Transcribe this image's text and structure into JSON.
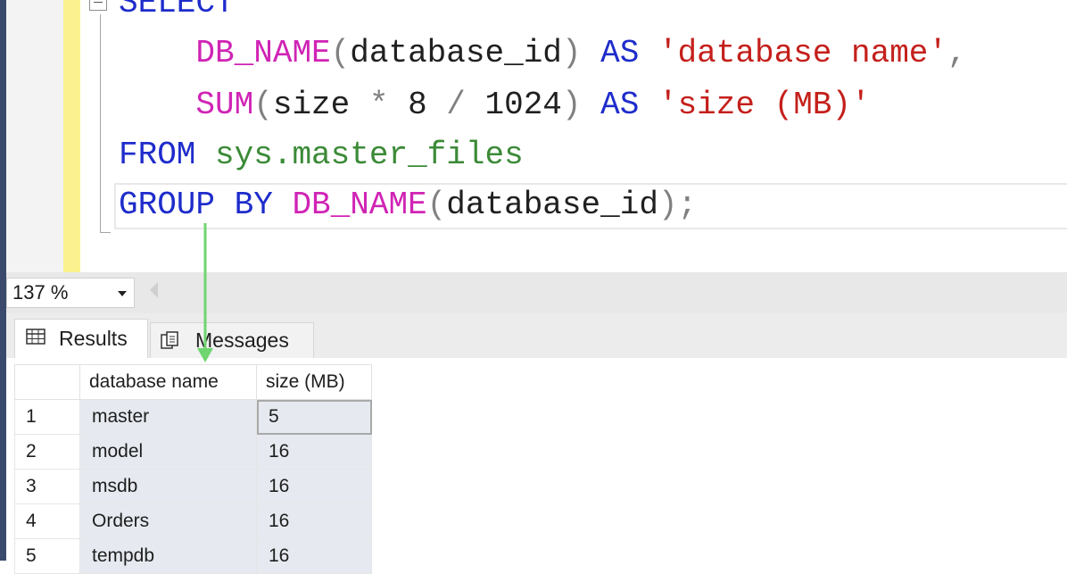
{
  "editor": {
    "lines": [
      {
        "indent": "",
        "tokens": [
          {
            "text": "SELECT",
            "cls": "kw"
          }
        ]
      },
      {
        "indent": "    ",
        "tokens": [
          {
            "text": "DB_NAME",
            "cls": "fn"
          },
          {
            "text": "(",
            "cls": "op"
          },
          {
            "text": "database_id",
            "cls": "dk"
          },
          {
            "text": ")",
            "cls": "op"
          },
          {
            "text": " ",
            "cls": "dk"
          },
          {
            "text": "AS",
            "cls": "kw"
          },
          {
            "text": " ",
            "cls": "dk"
          },
          {
            "text": "'database name'",
            "cls": "str"
          },
          {
            "text": ",",
            "cls": "op"
          }
        ]
      },
      {
        "indent": "    ",
        "tokens": [
          {
            "text": "SUM",
            "cls": "fn"
          },
          {
            "text": "(",
            "cls": "op"
          },
          {
            "text": "size",
            "cls": "dk"
          },
          {
            "text": " * ",
            "cls": "op"
          },
          {
            "text": "8",
            "cls": "dk"
          },
          {
            "text": " / ",
            "cls": "op"
          },
          {
            "text": "1024",
            "cls": "dk"
          },
          {
            "text": ")",
            "cls": "op"
          },
          {
            "text": " ",
            "cls": "dk"
          },
          {
            "text": "AS",
            "cls": "kw"
          },
          {
            "text": " ",
            "cls": "dk"
          },
          {
            "text": "'size (MB)'",
            "cls": "str"
          }
        ]
      },
      {
        "indent": "",
        "tokens": [
          {
            "text": "FROM",
            "cls": "kw"
          },
          {
            "text": " ",
            "cls": "dk"
          },
          {
            "text": "sys.master_files",
            "cls": "obj"
          }
        ]
      },
      {
        "indent": "",
        "tokens": [
          {
            "text": "GROUP BY",
            "cls": "kw"
          },
          {
            "text": " ",
            "cls": "dk"
          },
          {
            "text": "DB_NAME",
            "cls": "fn"
          },
          {
            "text": "(",
            "cls": "op"
          },
          {
            "text": "database_id",
            "cls": "dk"
          },
          {
            "text": ")",
            "cls": "op"
          },
          {
            "text": ";",
            "cls": "op"
          }
        ]
      }
    ]
  },
  "zoom": {
    "value": "137 %"
  },
  "tabs": {
    "results_label": "Results",
    "messages_label": "Messages"
  },
  "grid": {
    "columns": [
      "database name",
      "size (MB)"
    ],
    "rows": [
      {
        "num": "1",
        "name": "master",
        "size": "5"
      },
      {
        "num": "2",
        "name": "model",
        "size": "16"
      },
      {
        "num": "3",
        "name": "msdb",
        "size": "16"
      },
      {
        "num": "4",
        "name": "Orders",
        "size": "16"
      },
      {
        "num": "5",
        "name": "tempdb",
        "size": "16"
      }
    ]
  },
  "colors": {
    "keyword": "#1e2ccb",
    "function": "#d024b5",
    "string": "#c4201c",
    "object": "#3b8a37",
    "annotation_arrow": "#6fd56f"
  },
  "icons": [
    "collapse-box-icon",
    "dropdown-arrow-icon",
    "scroll-left-icon",
    "grid-icon",
    "messages-icon"
  ]
}
